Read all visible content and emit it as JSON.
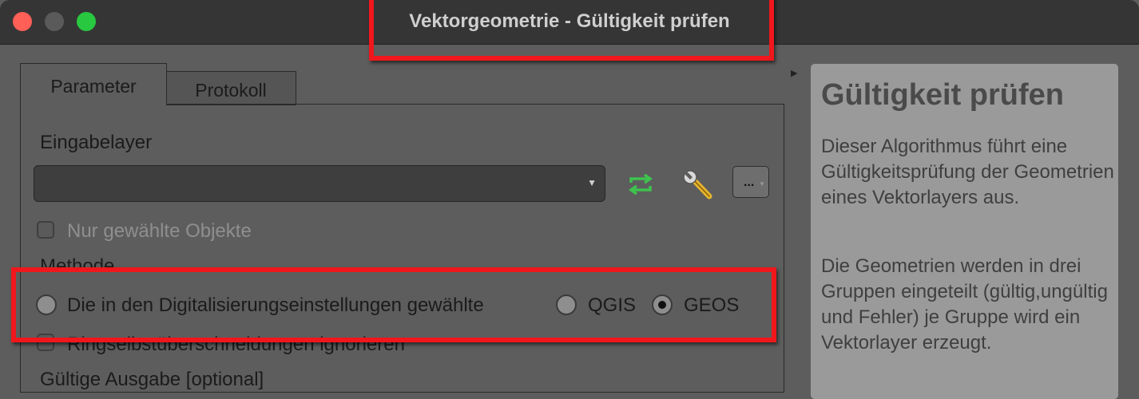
{
  "window": {
    "title": "Vektorgeometrie - Gültigkeit prüfen"
  },
  "tabs": [
    {
      "label": "Parameter",
      "active": true
    },
    {
      "label": "Protokoll",
      "active": false
    }
  ],
  "params": {
    "input_layer_label": "Eingabelayer",
    "input_layer_value": "",
    "more_button_label": "...",
    "selected_only_label": "Nur gewählte Objekte",
    "selected_only_checked": false,
    "method_label": "Methode",
    "method_options": [
      {
        "label": "Die in den Digitalisierungseinstellungen gewählte",
        "checked": false
      },
      {
        "label": "QGIS",
        "checked": false
      },
      {
        "label": "GEOS",
        "checked": true
      }
    ],
    "ignore_ring_label": "Ringselbstüberschneidungen ignorieren",
    "ignore_ring_checked": false,
    "valid_output_label": "Gültige Ausgabe [optional]"
  },
  "help": {
    "title": "Gültigkeit prüfen",
    "paragraph1": "Dieser Algorithmus führt eine Gültigkeitsprüfung der Geometrien eines Vektorlayers aus.",
    "paragraph2": "Die Geometrien werden in drei Gruppen eingeteilt (gültig,ungültig und Fehler) je Gruppe wird ein Vektorlayer erzeugt."
  },
  "colors": {
    "highlight": "#f0171c",
    "refresh_icon": "#3fc24e"
  }
}
